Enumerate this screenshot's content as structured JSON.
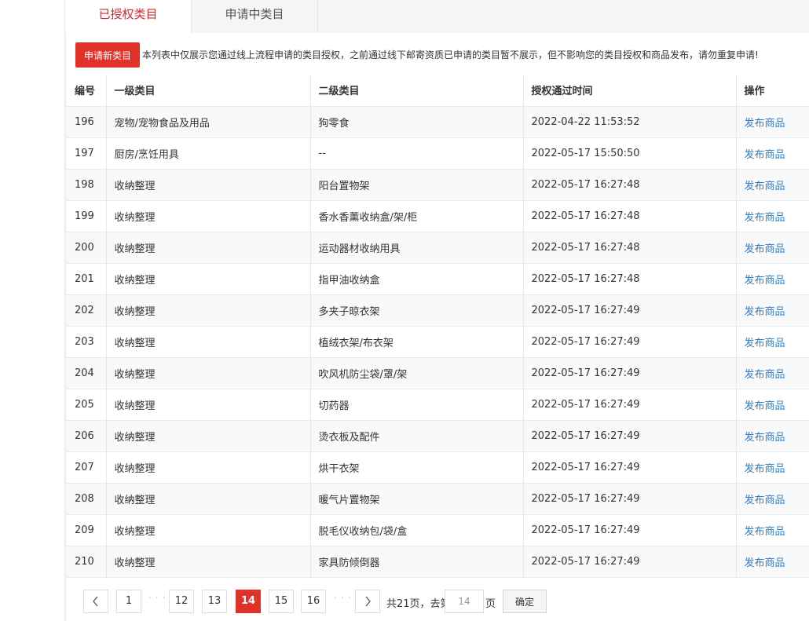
{
  "tabs": [
    {
      "label": "已授权类目",
      "active": true
    },
    {
      "label": "申请中类目",
      "active": false
    }
  ],
  "notice": {
    "button_label": "申请新类目",
    "text": "本列表中仅展示您通过线上流程申请的类目授权，之前通过线下邮寄资质已申请的类目暂不展示，但不影响您的类目授权和商品发布，请勿重复申请!"
  },
  "table": {
    "headers": [
      "编号",
      "一级类目",
      "二级类目",
      "授权通过时间",
      "操作"
    ],
    "rows": [
      {
        "id": "196",
        "level1": "宠物/宠物食品及用品",
        "level2": "狗零食",
        "time": "2022-04-22 11:53:52",
        "action": "发布商品"
      },
      {
        "id": "197",
        "level1": "厨房/烹饪用具",
        "level2": "--",
        "time": "2022-05-17 15:50:50",
        "action": "发布商品"
      },
      {
        "id": "198",
        "level1": "收纳整理",
        "level2": "阳台置物架",
        "time": "2022-05-17 16:27:48",
        "action": "发布商品"
      },
      {
        "id": "199",
        "level1": "收纳整理",
        "level2": "香水香薰收纳盒/架/柜",
        "time": "2022-05-17 16:27:48",
        "action": "发布商品"
      },
      {
        "id": "200",
        "level1": "收纳整理",
        "level2": "运动器材收纳用具",
        "time": "2022-05-17 16:27:48",
        "action": "发布商品"
      },
      {
        "id": "201",
        "level1": "收纳整理",
        "level2": "指甲油收纳盒",
        "time": "2022-05-17 16:27:48",
        "action": "发布商品"
      },
      {
        "id": "202",
        "level1": "收纳整理",
        "level2": "多夹子晾衣架",
        "time": "2022-05-17 16:27:49",
        "action": "发布商品"
      },
      {
        "id": "203",
        "level1": "收纳整理",
        "level2": "植绒衣架/布衣架",
        "time": "2022-05-17 16:27:49",
        "action": "发布商品"
      },
      {
        "id": "204",
        "level1": "收纳整理",
        "level2": "吹风机防尘袋/罩/架",
        "time": "2022-05-17 16:27:49",
        "action": "发布商品"
      },
      {
        "id": "205",
        "level1": "收纳整理",
        "level2": "切药器",
        "time": "2022-05-17 16:27:49",
        "action": "发布商品"
      },
      {
        "id": "206",
        "level1": "收纳整理",
        "level2": "烫衣板及配件",
        "time": "2022-05-17 16:27:49",
        "action": "发布商品"
      },
      {
        "id": "207",
        "level1": "收纳整理",
        "level2": "烘干衣架",
        "time": "2022-05-17 16:27:49",
        "action": "发布商品"
      },
      {
        "id": "208",
        "level1": "收纳整理",
        "level2": "暖气片置物架",
        "time": "2022-05-17 16:27:49",
        "action": "发布商品"
      },
      {
        "id": "209",
        "level1": "收纳整理",
        "level2": "脱毛仪收纳包/袋/盒",
        "time": "2022-05-17 16:27:49",
        "action": "发布商品"
      },
      {
        "id": "210",
        "level1": "收纳整理",
        "level2": "家具防倾倒器",
        "time": "2022-05-17 16:27:49",
        "action": "发布商品"
      }
    ]
  },
  "pagination": {
    "prev_icon": "chevron-left-icon",
    "next_icon": "chevron-right-icon",
    "pages": [
      "1",
      "12",
      "13",
      "14",
      "15",
      "16"
    ],
    "current": "14",
    "ellipsis": "· · ·",
    "total_text": "共21页，去第",
    "page_suffix": "页",
    "goto_value": "14",
    "confirm_label": "确定"
  }
}
